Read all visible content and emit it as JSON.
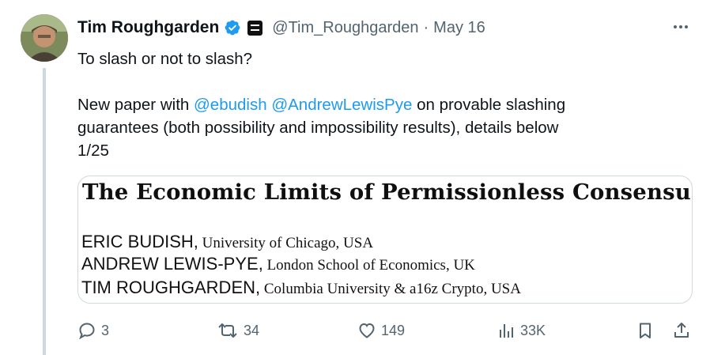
{
  "tweet": {
    "author": {
      "display_name": "Tim Roughgarden",
      "handle": "@Tim_Roughgarden",
      "separator": "·",
      "date": "May 16"
    },
    "text_lines": [
      "To slash or not to slash?",
      "",
      "New paper with ",
      "@ebudish",
      " ",
      "@AndrewLewisPye",
      " on provable slashing",
      "guarantees (both possibility and impossibility results), details below",
      "1/25"
    ],
    "card": {
      "title": "The Economic Limits of Permissionless Consensus",
      "authors": [
        {
          "name": "ERIC BUDISH,",
          "affiliation": " University of Chicago, USA"
        },
        {
          "name": "ANDREW LEWIS-PYE,",
          "affiliation": " London School of Economics, UK"
        },
        {
          "name": "TIM ROUGHGARDEN,",
          "affiliation": " Columbia University & a16z Crypto, USA"
        }
      ]
    },
    "actions": {
      "replies": "3",
      "retweets": "34",
      "likes": "149",
      "views": "33K"
    },
    "colors": {
      "accent": "#1d9bf0",
      "text": "#0f1419",
      "secondary": "#536471",
      "border": "#cfd9de"
    },
    "icons": {
      "verified": "verified-badge-icon",
      "affiliate": "affiliate-badge-icon",
      "more": "more-dots-icon",
      "reply": "reply-icon",
      "retweet": "retweet-icon",
      "like": "heart-icon",
      "views": "views-chart-icon",
      "bookmark": "bookmark-icon",
      "share": "share-icon"
    }
  }
}
